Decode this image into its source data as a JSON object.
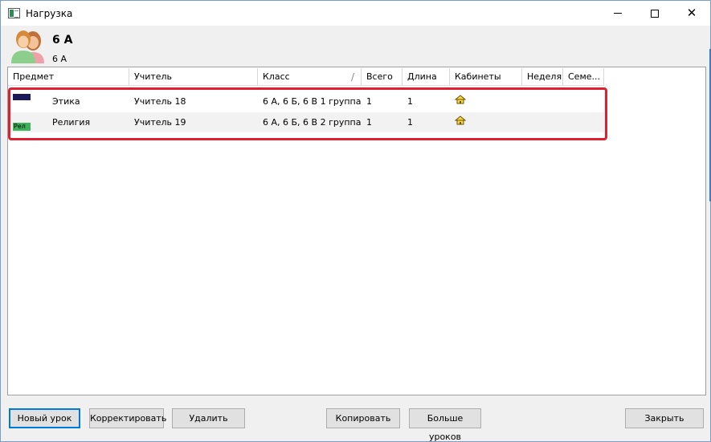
{
  "window": {
    "title": "Нагрузка"
  },
  "header": {
    "title": "6 А",
    "subtitle": "6 А"
  },
  "grid": {
    "columns": [
      "Предмет",
      "Учитель",
      "Класс",
      "Всего",
      "Длина",
      "Кабинеты",
      "Неделя",
      "Семе..."
    ],
    "sort_indicator": "/",
    "rows": [
      {
        "subject": "Этика",
        "badge": "",
        "teacher": "Учитель 18",
        "class": "6 А, 6 Б, 6 В 1 группа",
        "total": "1",
        "length": "1"
      },
      {
        "subject": "Религия",
        "badge": "Рел",
        "teacher": "Учитель 19",
        "class": "6 А, 6 Б, 6 В 2 группа",
        "total": "1",
        "length": "1"
      }
    ]
  },
  "buttons": {
    "new_lesson": "Новый урок",
    "edit": "Корректировать",
    "delete": "Удалить",
    "copy": "Копировать",
    "more_lessons": "Больше уроков",
    "close": "Закрыть"
  },
  "colors": {
    "highlight": "#e02030",
    "row1_swatch": "#1a1a5a",
    "row2_swatch": "#3cb35a",
    "accent": "#0078d7"
  }
}
